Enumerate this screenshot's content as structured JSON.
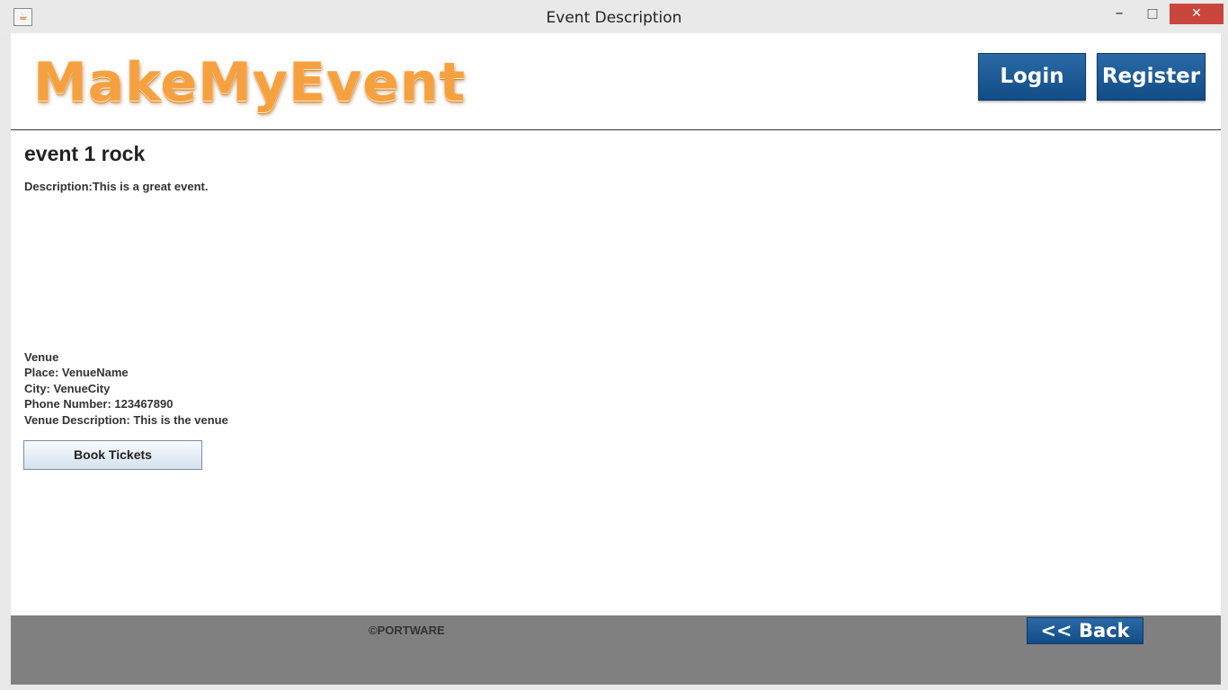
{
  "window": {
    "title": "Event Description",
    "minimize_glyph": "–",
    "maximize_glyph": "□",
    "close_glyph": "✕",
    "app_icon": "java-cup-icon"
  },
  "header": {
    "logo_text": "MakeMyEvent",
    "login_label": "Login",
    "register_label": "Register"
  },
  "event": {
    "title": "event 1 rock",
    "description": "Description:This is a great event."
  },
  "venue": {
    "heading": "Venue",
    "place": "Place: VenueName",
    "city": "City: VenueCity",
    "phone": "Phone Number: 123467890",
    "description": "Venue Description: This is the venue"
  },
  "actions": {
    "book_label": "Book Tickets"
  },
  "footer": {
    "copyright": "©PORTWARE",
    "back_label": "<< Back"
  },
  "colors": {
    "brand_orange": "#f6a13f",
    "button_blue": "#124c86",
    "footer_gray": "#808080",
    "close_red": "#c9463d"
  }
}
